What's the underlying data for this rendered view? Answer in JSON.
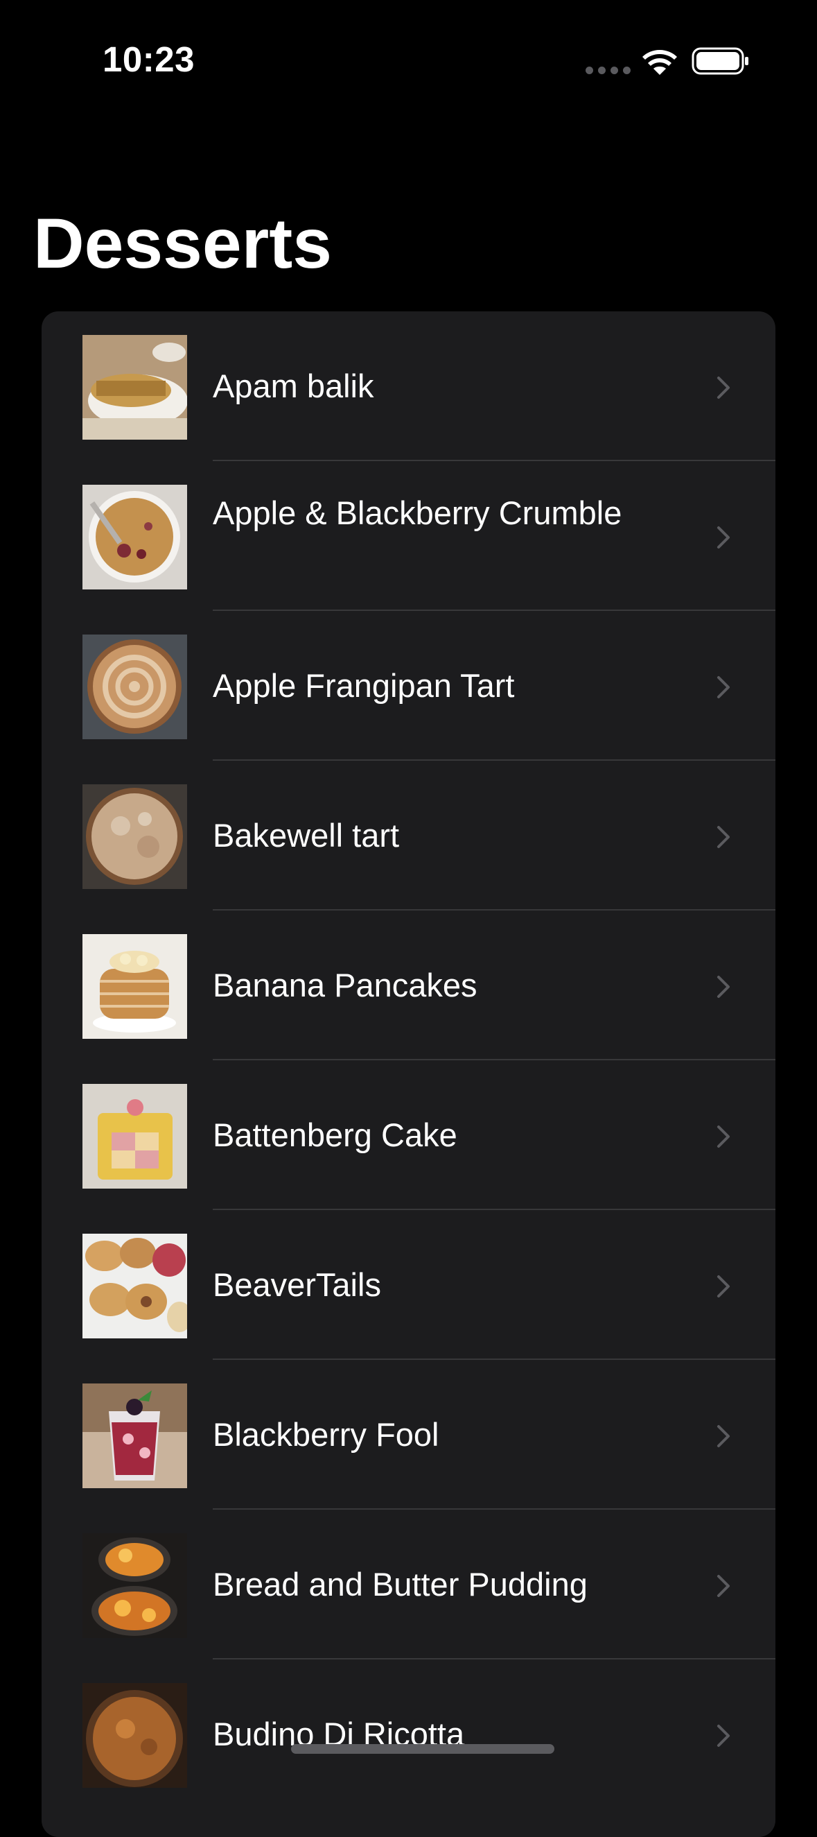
{
  "status_bar": {
    "time": "10:23",
    "icons": [
      "cellular-dots-icon",
      "wifi-icon",
      "battery-icon"
    ]
  },
  "navigation": {
    "title": "Desserts"
  },
  "list": {
    "items": [
      {
        "label": "Apam balik",
        "thumbnail": "apam-balik-thumbnail"
      },
      {
        "label": "Apple & Blackberry Crumble",
        "thumbnail": "apple-blackberry-crumble-thumbnail"
      },
      {
        "label": "Apple Frangipan Tart",
        "thumbnail": "apple-frangipan-tart-thumbnail"
      },
      {
        "label": "Bakewell tart",
        "thumbnail": "bakewell-tart-thumbnail"
      },
      {
        "label": "Banana Pancakes",
        "thumbnail": "banana-pancakes-thumbnail"
      },
      {
        "label": "Battenberg Cake",
        "thumbnail": "battenberg-cake-thumbnail"
      },
      {
        "label": "BeaverTails",
        "thumbnail": "beavertails-thumbnail"
      },
      {
        "label": "Blackberry Fool",
        "thumbnail": "blackberry-fool-thumbnail"
      },
      {
        "label": "Bread and Butter Pudding",
        "thumbnail": "bread-butter-pudding-thumbnail"
      },
      {
        "label": "Budino Di Ricotta",
        "thumbnail": "budino-di-ricotta-thumbnail"
      }
    ]
  },
  "colors": {
    "background": "#000000",
    "card": "#1c1c1e",
    "separator": "#38383a",
    "chevron": "#5b5b5f",
    "text": "#ffffff"
  }
}
